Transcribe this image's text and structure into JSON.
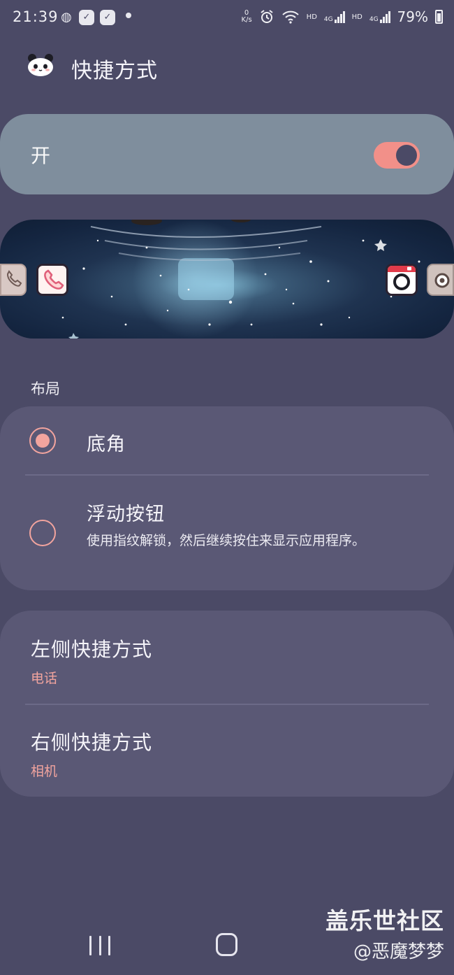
{
  "status_bar": {
    "time": "21:39",
    "net_speed_value": "0",
    "net_speed_unit": "K/s",
    "signal_1": "HD",
    "signal_1_net": "4G",
    "signal_2": "HD",
    "signal_2_net": "4G",
    "battery": "79%",
    "icons": [
      "wechat-icon",
      "check-notification-icon",
      "check-notification-icon",
      "alarm-icon",
      "wifi-icon",
      "battery-icon"
    ]
  },
  "header": {
    "title": "快捷方式",
    "icon": "panda-icon"
  },
  "master_switch": {
    "label": "开",
    "enabled": true,
    "accent_color": "#f29089"
  },
  "preview": {
    "left_shortcut_icon": "phone-icon",
    "right_shortcut_icon": "camera-icon"
  },
  "layout_section": {
    "label": "布局",
    "options": [
      {
        "title": "底角",
        "selected": true
      },
      {
        "title": "浮动按钮",
        "description": "使用指纹解锁，然后继续按住来显示应用程序。",
        "selected": false
      }
    ]
  },
  "shortcuts": {
    "left": {
      "title": "左侧快捷方式",
      "value": "电话"
    },
    "right": {
      "title": "右侧快捷方式",
      "value": "相机"
    }
  },
  "watermark": {
    "line1": "盖乐世社区",
    "line2": "@恶魔梦梦"
  },
  "nav_bar": {
    "icons": [
      "recents-icon",
      "home-icon"
    ]
  }
}
